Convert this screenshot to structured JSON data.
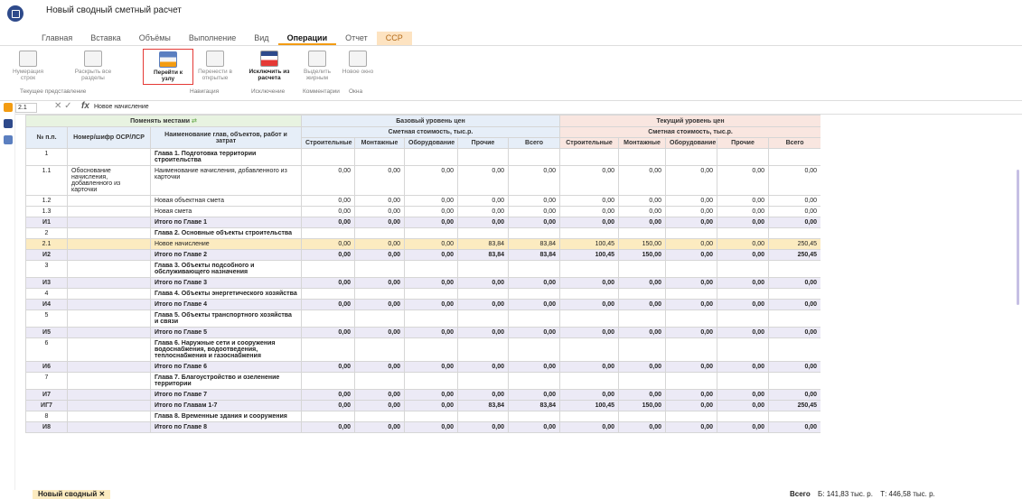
{
  "app": {
    "title": "Новый сводный сметный расчет"
  },
  "tabs": [
    "Главная",
    "Вставка",
    "Объёмы",
    "Выполнение",
    "Вид",
    "Операции",
    "Отчет",
    "ССР"
  ],
  "ribbon": {
    "buttons": [
      "Нумерация строк",
      "Раскрыть все разделы",
      "Перейти к узлу",
      "Перенести в открытые",
      "Исключить из расчета",
      "Выделить жирным",
      "Новое окно"
    ],
    "groups": [
      "Текущее представление",
      "Навигация",
      "Исключение",
      "Комментарии",
      "Окна"
    ]
  },
  "formula": {
    "cell": "2.1",
    "value": "Новое начисление"
  },
  "headers": {
    "swap": "Поменять местами",
    "base": "Базовый уровень цен",
    "current": "Текущий уровень цен",
    "cost": "Сметная стоимость, тыс.р.",
    "num": "№ п.п.",
    "code": "Номер/шифр ОСР/ЛСР",
    "name": "Наименование глав, объектов, работ и затрат",
    "cols": [
      "Строительные",
      "Монтажные",
      "Оборудование",
      "Прочие",
      "Всего"
    ]
  },
  "rows": [
    {
      "t": "ch",
      "n": "1",
      "c": "",
      "name": "Глава 1. Подготовка территории строительства",
      "v": []
    },
    {
      "t": "r",
      "n": "1.1",
      "c": "Обоснование начисления, добавленного из карточки",
      "name": "Наименование начисления, добавленного из карточки",
      "v": [
        "0,00",
        "0,00",
        "0,00",
        "0,00",
        "0,00",
        "0,00",
        "0,00",
        "0,00",
        "0,00",
        "0,00"
      ]
    },
    {
      "t": "r",
      "n": "1.2",
      "c": "",
      "name": "Новая объектная смета",
      "v": [
        "0,00",
        "0,00",
        "0,00",
        "0,00",
        "0,00",
        "0,00",
        "0,00",
        "0,00",
        "0,00",
        "0,00"
      ]
    },
    {
      "t": "r",
      "n": "1.3",
      "c": "",
      "name": "Новая смета",
      "v": [
        "0,00",
        "0,00",
        "0,00",
        "0,00",
        "0,00",
        "0,00",
        "0,00",
        "0,00",
        "0,00",
        "0,00"
      ]
    },
    {
      "t": "tot",
      "n": "И1",
      "c": "",
      "name": "Итого по Главе 1",
      "v": [
        "0,00",
        "0,00",
        "0,00",
        "0,00",
        "0,00",
        "0,00",
        "0,00",
        "0,00",
        "0,00",
        "0,00"
      ]
    },
    {
      "t": "ch",
      "n": "2",
      "c": "",
      "name": "Глава 2. Основные объекты строительства",
      "v": []
    },
    {
      "t": "sel",
      "n": "2.1",
      "c": "",
      "name": "Новое начисление",
      "v": [
        "0,00",
        "0,00",
        "0,00",
        "83,84",
        "83,84",
        "100,45",
        "150,00",
        "0,00",
        "0,00",
        "250,45"
      ]
    },
    {
      "t": "tot",
      "n": "И2",
      "c": "",
      "name": "Итого по Главе 2",
      "v": [
        "0,00",
        "0,00",
        "0,00",
        "83,84",
        "83,84",
        "100,45",
        "150,00",
        "0,00",
        "0,00",
        "250,45"
      ]
    },
    {
      "t": "ch",
      "n": "3",
      "c": "",
      "name": "Глава 3. Объекты подсобного и обслуживающего назначения",
      "v": []
    },
    {
      "t": "tot",
      "n": "И3",
      "c": "",
      "name": "Итого по Главе 3",
      "v": [
        "0,00",
        "0,00",
        "0,00",
        "0,00",
        "0,00",
        "0,00",
        "0,00",
        "0,00",
        "0,00",
        "0,00"
      ]
    },
    {
      "t": "ch",
      "n": "4",
      "c": "",
      "name": "Глава 4. Объекты энергетического хозяйства",
      "v": []
    },
    {
      "t": "tot",
      "n": "И4",
      "c": "",
      "name": "Итого по Главе 4",
      "v": [
        "0,00",
        "0,00",
        "0,00",
        "0,00",
        "0,00",
        "0,00",
        "0,00",
        "0,00",
        "0,00",
        "0,00"
      ]
    },
    {
      "t": "ch",
      "n": "5",
      "c": "",
      "name": "Глава 5. Объекты транспортного хозяйства и связи",
      "v": []
    },
    {
      "t": "tot",
      "n": "И5",
      "c": "",
      "name": "Итого по Главе 5",
      "v": [
        "0,00",
        "0,00",
        "0,00",
        "0,00",
        "0,00",
        "0,00",
        "0,00",
        "0,00",
        "0,00",
        "0,00"
      ]
    },
    {
      "t": "ch",
      "n": "6",
      "c": "",
      "name": "Глава 6. Наружные сети и сооружения водоснабжения, водоотведения, теплоснабжения и газоснабжения",
      "v": []
    },
    {
      "t": "tot",
      "n": "И6",
      "c": "",
      "name": "Итого по Главе 6",
      "v": [
        "0,00",
        "0,00",
        "0,00",
        "0,00",
        "0,00",
        "0,00",
        "0,00",
        "0,00",
        "0,00",
        "0,00"
      ]
    },
    {
      "t": "ch",
      "n": "7",
      "c": "",
      "name": "Глава 7. Благоустройство и озеленение территории",
      "v": []
    },
    {
      "t": "tot",
      "n": "И7",
      "c": "",
      "name": "Итого по Главе 7",
      "v": [
        "0,00",
        "0,00",
        "0,00",
        "0,00",
        "0,00",
        "0,00",
        "0,00",
        "0,00",
        "0,00",
        "0,00"
      ]
    },
    {
      "t": "tot",
      "n": "ИГ7",
      "c": "",
      "name": "Итого по Главам 1-7",
      "v": [
        "0,00",
        "0,00",
        "0,00",
        "83,84",
        "83,84",
        "100,45",
        "150,00",
        "0,00",
        "0,00",
        "250,45"
      ]
    },
    {
      "t": "ch",
      "n": "8",
      "c": "",
      "name": "Глава 8. Временные здания и сооружения",
      "v": []
    },
    {
      "t": "tot",
      "n": "И8",
      "c": "",
      "name": "Итого по Главе 8",
      "v": [
        "0,00",
        "0,00",
        "0,00",
        "0,00",
        "0,00",
        "0,00",
        "0,00",
        "0,00",
        "0,00",
        "0,00"
      ]
    }
  ],
  "footer": {
    "sheet": "Новый сводный",
    "total_label": "Всего",
    "total_b": "Б: 141,83 тыс. р.",
    "total_t": "Т: 446,58 тыс. р."
  }
}
